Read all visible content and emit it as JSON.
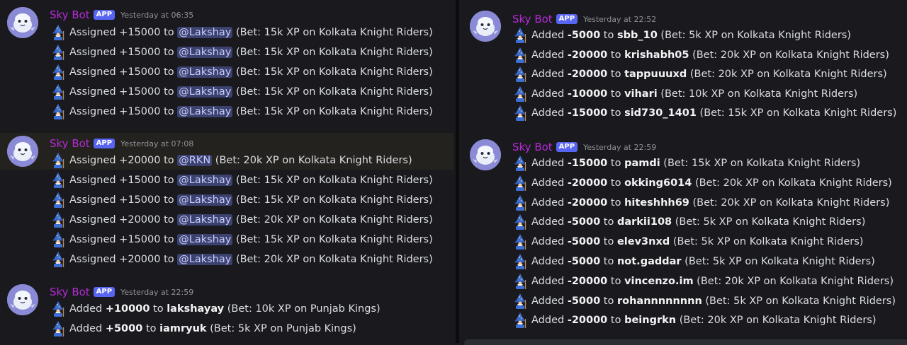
{
  "colors": {
    "background": "#1a1a1e",
    "username": "#b52bd6",
    "app_badge": "#5865f2",
    "mention_bg": "#3c4270",
    "mention_text": "#c9cdfb"
  },
  "left": {
    "groups": [
      {
        "username": "Sky Bot",
        "badge": "APP",
        "timestamp": "Yesterday at 06:35",
        "lines": [
          {
            "pre": "Assigned +15000 to",
            "mention": "@Lakshay",
            "post": "(Bet: 15k XP on Kolkata Knight Riders)"
          },
          {
            "pre": "Assigned +15000 to",
            "mention": "@Lakshay",
            "post": "(Bet: 15k XP on Kolkata Knight Riders)"
          },
          {
            "pre": "Assigned +15000 to",
            "mention": "@Lakshay",
            "post": "(Bet: 15k XP on Kolkata Knight Riders)"
          },
          {
            "pre": "Assigned +15000 to",
            "mention": "@Lakshay",
            "post": "(Bet: 15k XP on Kolkata Knight Riders)"
          },
          {
            "pre": "Assigned +15000 to",
            "mention": "@Lakshay",
            "post": "(Bet: 15k XP on Kolkata Knight Riders)"
          }
        ]
      },
      {
        "username": "Sky Bot",
        "badge": "APP",
        "timestamp": "Yesterday at 07:08",
        "lines": [
          {
            "pre": "Assigned +20000 to",
            "mention": "@RKN",
            "post": "(Bet: 20k XP on Kolkata Knight Riders)"
          },
          {
            "pre": "Assigned +15000 to",
            "mention": "@Lakshay",
            "post": "(Bet: 15k XP on Kolkata Knight Riders)"
          },
          {
            "pre": "Assigned +15000 to",
            "mention": "@Lakshay",
            "post": "(Bet: 15k XP on Kolkata Knight Riders)"
          },
          {
            "pre": "Assigned +20000 to",
            "mention": "@Lakshay",
            "post": "(Bet: 20k XP on Kolkata Knight Riders)"
          },
          {
            "pre": "Assigned +15000 to",
            "mention": "@Lakshay",
            "post": "(Bet: 15k XP on Kolkata Knight Riders)"
          },
          {
            "pre": "Assigned +20000 to",
            "mention": "@Lakshay",
            "post": "(Bet: 20k XP on Kolkata Knight Riders)"
          }
        ]
      },
      {
        "username": "Sky Bot",
        "badge": "APP",
        "timestamp": "Yesterday at 22:59",
        "lines": [
          {
            "pre": "Added",
            "amount": "+10000",
            "mid": "to",
            "user": "lakshayay",
            "post": "(Bet: 10k XP on Punjab Kings)"
          },
          {
            "pre": "Added",
            "amount": "+5000",
            "mid": "to",
            "user": "iamryuk",
            "post": "(Bet: 5k XP on Punjab Kings)"
          }
        ]
      }
    ]
  },
  "right": {
    "groups": [
      {
        "username": "Sky Bot",
        "badge": "APP",
        "timestamp": "Yesterday at 22:52",
        "lines": [
          {
            "pre": "Added",
            "amount": "-5000",
            "mid": "to",
            "user": "sbb_10",
            "post": "(Bet: 5k XP on Kolkata Knight Riders)"
          },
          {
            "pre": "Added",
            "amount": "-20000",
            "mid": "to",
            "user": "krishabh05",
            "post": "(Bet: 20k XP on Kolkata Knight Riders)"
          },
          {
            "pre": "Added",
            "amount": "-20000",
            "mid": "to",
            "user": "tappuuuxd",
            "post": "(Bet: 20k XP on Kolkata Knight Riders)"
          },
          {
            "pre": "Added",
            "amount": "-10000",
            "mid": "to",
            "user": "vihari",
            "post": "(Bet: 10k XP on Kolkata Knight Riders)"
          },
          {
            "pre": "Added",
            "amount": "-15000",
            "mid": "to",
            "user": "sid730_1401",
            "post": "(Bet: 15k XP on Kolkata Knight Riders)"
          }
        ]
      },
      {
        "username": "Sky Bot",
        "badge": "APP",
        "timestamp": "Yesterday at 22:59",
        "lines": [
          {
            "pre": "Added",
            "amount": "-15000",
            "mid": "to",
            "user": "pamdi",
            "post": "(Bet: 15k XP on Kolkata Knight Riders)"
          },
          {
            "pre": "Added",
            "amount": "-20000",
            "mid": "to",
            "user": "okking6014",
            "post": "(Bet: 20k XP on Kolkata Knight Riders)"
          },
          {
            "pre": "Added",
            "amount": "-20000",
            "mid": "to",
            "user": "hiteshhh69",
            "post": "(Bet: 20k XP on Kolkata Knight Riders)"
          },
          {
            "pre": "Added",
            "amount": "-5000",
            "mid": "to",
            "user": "darkii108",
            "post": "(Bet: 5k XP on Kolkata Knight Riders)"
          },
          {
            "pre": "Added",
            "amount": "-5000",
            "mid": "to",
            "user": "elev3nxd",
            "post": "(Bet: 5k XP on Kolkata Knight Riders)"
          },
          {
            "pre": "Added",
            "amount": "-5000",
            "mid": "to",
            "user": "not.gaddar",
            "post": "(Bet: 5k XP on Kolkata Knight Riders)"
          },
          {
            "pre": "Added",
            "amount": "-20000",
            "mid": "to",
            "user": "vincenzo.im",
            "post": "(Bet: 20k XP on Kolkata Knight Riders)"
          },
          {
            "pre": "Added",
            "amount": "-5000",
            "mid": "to",
            "user": "rohannnnnnnn",
            "post": "(Bet: 5k XP on Kolkata Knight Riders)"
          },
          {
            "pre": "Added",
            "amount": "-20000",
            "mid": "to",
            "user": "beingrkn",
            "post": "(Bet: 20k XP on Kolkata Knight Riders)"
          }
        ]
      }
    ]
  }
}
